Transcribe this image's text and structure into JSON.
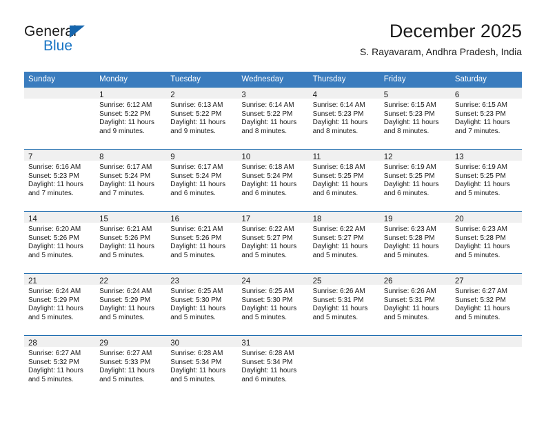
{
  "brand": {
    "name_top": "General",
    "name_bottom": "Blue",
    "accent_color": "#1874c4",
    "triangle_color": "#1565ad"
  },
  "header": {
    "title": "December 2025",
    "subtitle": "S. Rayavaram, Andhra Pradesh, India"
  },
  "theme": {
    "header_row_bg": "#3a7cbe",
    "header_row_text": "#ffffff",
    "cell_border": "#1d6cb0",
    "daynum_band_bg": "#f0f0f0",
    "page_bg": "#ffffff",
    "text": "#1a1a1a"
  },
  "weekday_headers": [
    "Sunday",
    "Monday",
    "Tuesday",
    "Wednesday",
    "Thursday",
    "Friday",
    "Saturday"
  ],
  "labels": {
    "sunrise_prefix": "Sunrise:",
    "sunset_prefix": "Sunset:",
    "daylight_prefix": "Daylight:"
  },
  "weeks": [
    [
      {
        "blank": true
      },
      {
        "day": "1",
        "sunrise": "Sunrise: 6:12 AM",
        "sunset": "Sunset: 5:22 PM",
        "daylight_line1": "Daylight: 11 hours",
        "daylight_line2": "and 9 minutes."
      },
      {
        "day": "2",
        "sunrise": "Sunrise: 6:13 AM",
        "sunset": "Sunset: 5:22 PM",
        "daylight_line1": "Daylight: 11 hours",
        "daylight_line2": "and 9 minutes."
      },
      {
        "day": "3",
        "sunrise": "Sunrise: 6:14 AM",
        "sunset": "Sunset: 5:22 PM",
        "daylight_line1": "Daylight: 11 hours",
        "daylight_line2": "and 8 minutes."
      },
      {
        "day": "4",
        "sunrise": "Sunrise: 6:14 AM",
        "sunset": "Sunset: 5:23 PM",
        "daylight_line1": "Daylight: 11 hours",
        "daylight_line2": "and 8 minutes."
      },
      {
        "day": "5",
        "sunrise": "Sunrise: 6:15 AM",
        "sunset": "Sunset: 5:23 PM",
        "daylight_line1": "Daylight: 11 hours",
        "daylight_line2": "and 8 minutes."
      },
      {
        "day": "6",
        "sunrise": "Sunrise: 6:15 AM",
        "sunset": "Sunset: 5:23 PM",
        "daylight_line1": "Daylight: 11 hours",
        "daylight_line2": "and 7 minutes."
      }
    ],
    [
      {
        "day": "7",
        "sunrise": "Sunrise: 6:16 AM",
        "sunset": "Sunset: 5:23 PM",
        "daylight_line1": "Daylight: 11 hours",
        "daylight_line2": "and 7 minutes."
      },
      {
        "day": "8",
        "sunrise": "Sunrise: 6:17 AM",
        "sunset": "Sunset: 5:24 PM",
        "daylight_line1": "Daylight: 11 hours",
        "daylight_line2": "and 7 minutes."
      },
      {
        "day": "9",
        "sunrise": "Sunrise: 6:17 AM",
        "sunset": "Sunset: 5:24 PM",
        "daylight_line1": "Daylight: 11 hours",
        "daylight_line2": "and 6 minutes."
      },
      {
        "day": "10",
        "sunrise": "Sunrise: 6:18 AM",
        "sunset": "Sunset: 5:24 PM",
        "daylight_line1": "Daylight: 11 hours",
        "daylight_line2": "and 6 minutes."
      },
      {
        "day": "11",
        "sunrise": "Sunrise: 6:18 AM",
        "sunset": "Sunset: 5:25 PM",
        "daylight_line1": "Daylight: 11 hours",
        "daylight_line2": "and 6 minutes."
      },
      {
        "day": "12",
        "sunrise": "Sunrise: 6:19 AM",
        "sunset": "Sunset: 5:25 PM",
        "daylight_line1": "Daylight: 11 hours",
        "daylight_line2": "and 6 minutes."
      },
      {
        "day": "13",
        "sunrise": "Sunrise: 6:19 AM",
        "sunset": "Sunset: 5:25 PM",
        "daylight_line1": "Daylight: 11 hours",
        "daylight_line2": "and 5 minutes."
      }
    ],
    [
      {
        "day": "14",
        "sunrise": "Sunrise: 6:20 AM",
        "sunset": "Sunset: 5:26 PM",
        "daylight_line1": "Daylight: 11 hours",
        "daylight_line2": "and 5 minutes."
      },
      {
        "day": "15",
        "sunrise": "Sunrise: 6:21 AM",
        "sunset": "Sunset: 5:26 PM",
        "daylight_line1": "Daylight: 11 hours",
        "daylight_line2": "and 5 minutes."
      },
      {
        "day": "16",
        "sunrise": "Sunrise: 6:21 AM",
        "sunset": "Sunset: 5:26 PM",
        "daylight_line1": "Daylight: 11 hours",
        "daylight_line2": "and 5 minutes."
      },
      {
        "day": "17",
        "sunrise": "Sunrise: 6:22 AM",
        "sunset": "Sunset: 5:27 PM",
        "daylight_line1": "Daylight: 11 hours",
        "daylight_line2": "and 5 minutes."
      },
      {
        "day": "18",
        "sunrise": "Sunrise: 6:22 AM",
        "sunset": "Sunset: 5:27 PM",
        "daylight_line1": "Daylight: 11 hours",
        "daylight_line2": "and 5 minutes."
      },
      {
        "day": "19",
        "sunrise": "Sunrise: 6:23 AM",
        "sunset": "Sunset: 5:28 PM",
        "daylight_line1": "Daylight: 11 hours",
        "daylight_line2": "and 5 minutes."
      },
      {
        "day": "20",
        "sunrise": "Sunrise: 6:23 AM",
        "sunset": "Sunset: 5:28 PM",
        "daylight_line1": "Daylight: 11 hours",
        "daylight_line2": "and 5 minutes."
      }
    ],
    [
      {
        "day": "21",
        "sunrise": "Sunrise: 6:24 AM",
        "sunset": "Sunset: 5:29 PM",
        "daylight_line1": "Daylight: 11 hours",
        "daylight_line2": "and 5 minutes."
      },
      {
        "day": "22",
        "sunrise": "Sunrise: 6:24 AM",
        "sunset": "Sunset: 5:29 PM",
        "daylight_line1": "Daylight: 11 hours",
        "daylight_line2": "and 5 minutes."
      },
      {
        "day": "23",
        "sunrise": "Sunrise: 6:25 AM",
        "sunset": "Sunset: 5:30 PM",
        "daylight_line1": "Daylight: 11 hours",
        "daylight_line2": "and 5 minutes."
      },
      {
        "day": "24",
        "sunrise": "Sunrise: 6:25 AM",
        "sunset": "Sunset: 5:30 PM",
        "daylight_line1": "Daylight: 11 hours",
        "daylight_line2": "and 5 minutes."
      },
      {
        "day": "25",
        "sunrise": "Sunrise: 6:26 AM",
        "sunset": "Sunset: 5:31 PM",
        "daylight_line1": "Daylight: 11 hours",
        "daylight_line2": "and 5 minutes."
      },
      {
        "day": "26",
        "sunrise": "Sunrise: 6:26 AM",
        "sunset": "Sunset: 5:31 PM",
        "daylight_line1": "Daylight: 11 hours",
        "daylight_line2": "and 5 minutes."
      },
      {
        "day": "27",
        "sunrise": "Sunrise: 6:27 AM",
        "sunset": "Sunset: 5:32 PM",
        "daylight_line1": "Daylight: 11 hours",
        "daylight_line2": "and 5 minutes."
      }
    ],
    [
      {
        "day": "28",
        "sunrise": "Sunrise: 6:27 AM",
        "sunset": "Sunset: 5:32 PM",
        "daylight_line1": "Daylight: 11 hours",
        "daylight_line2": "and 5 minutes."
      },
      {
        "day": "29",
        "sunrise": "Sunrise: 6:27 AM",
        "sunset": "Sunset: 5:33 PM",
        "daylight_line1": "Daylight: 11 hours",
        "daylight_line2": "and 5 minutes."
      },
      {
        "day": "30",
        "sunrise": "Sunrise: 6:28 AM",
        "sunset": "Sunset: 5:34 PM",
        "daylight_line1": "Daylight: 11 hours",
        "daylight_line2": "and 5 minutes."
      },
      {
        "day": "31",
        "sunrise": "Sunrise: 6:28 AM",
        "sunset": "Sunset: 5:34 PM",
        "daylight_line1": "Daylight: 11 hours",
        "daylight_line2": "and 6 minutes."
      },
      {
        "blank": true
      },
      {
        "blank": true
      },
      {
        "blank": true
      }
    ]
  ]
}
